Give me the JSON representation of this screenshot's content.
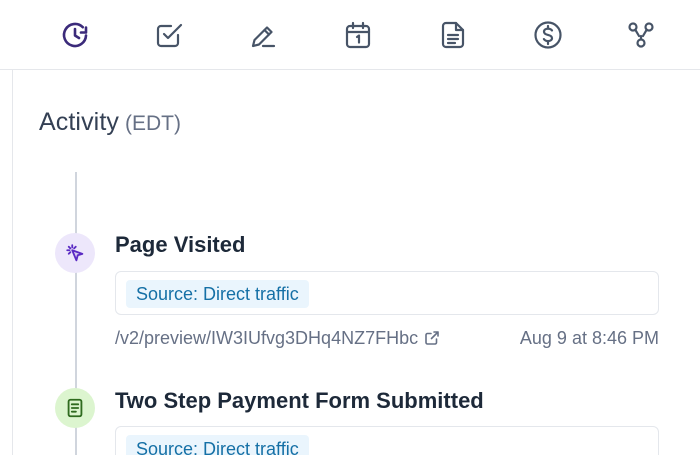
{
  "toolbar": {
    "icons": [
      {
        "name": "activity-history-icon",
        "active": true
      },
      {
        "name": "task-checkbox-icon",
        "active": false
      },
      {
        "name": "note-pencil-icon",
        "active": false
      },
      {
        "name": "calendar-icon",
        "active": false
      },
      {
        "name": "document-icon",
        "active": false
      },
      {
        "name": "dollar-icon",
        "active": false
      },
      {
        "name": "workflow-icon",
        "active": false
      }
    ]
  },
  "activity": {
    "title": "Activity",
    "timezone": "(EDT)"
  },
  "events": [
    {
      "icon": "cursor-click-icon",
      "title": "Page Visited",
      "source": "Source: Direct traffic",
      "link": "/v2/preview/IW3IUfvg3DHq4NZ7FHbc",
      "time": "Aug 9 at 8:46 PM"
    },
    {
      "icon": "form-icon",
      "title": "Two Step Payment Form Submitted",
      "source": "Source: Direct traffic"
    }
  ],
  "colors": {
    "active_icon": "#3b2a7a",
    "visit_icon_bg": "#ede7fb",
    "form_icon_bg": "#dcf5cf",
    "badge_bg": "#eaf5fd",
    "badge_text": "#1570a6"
  }
}
